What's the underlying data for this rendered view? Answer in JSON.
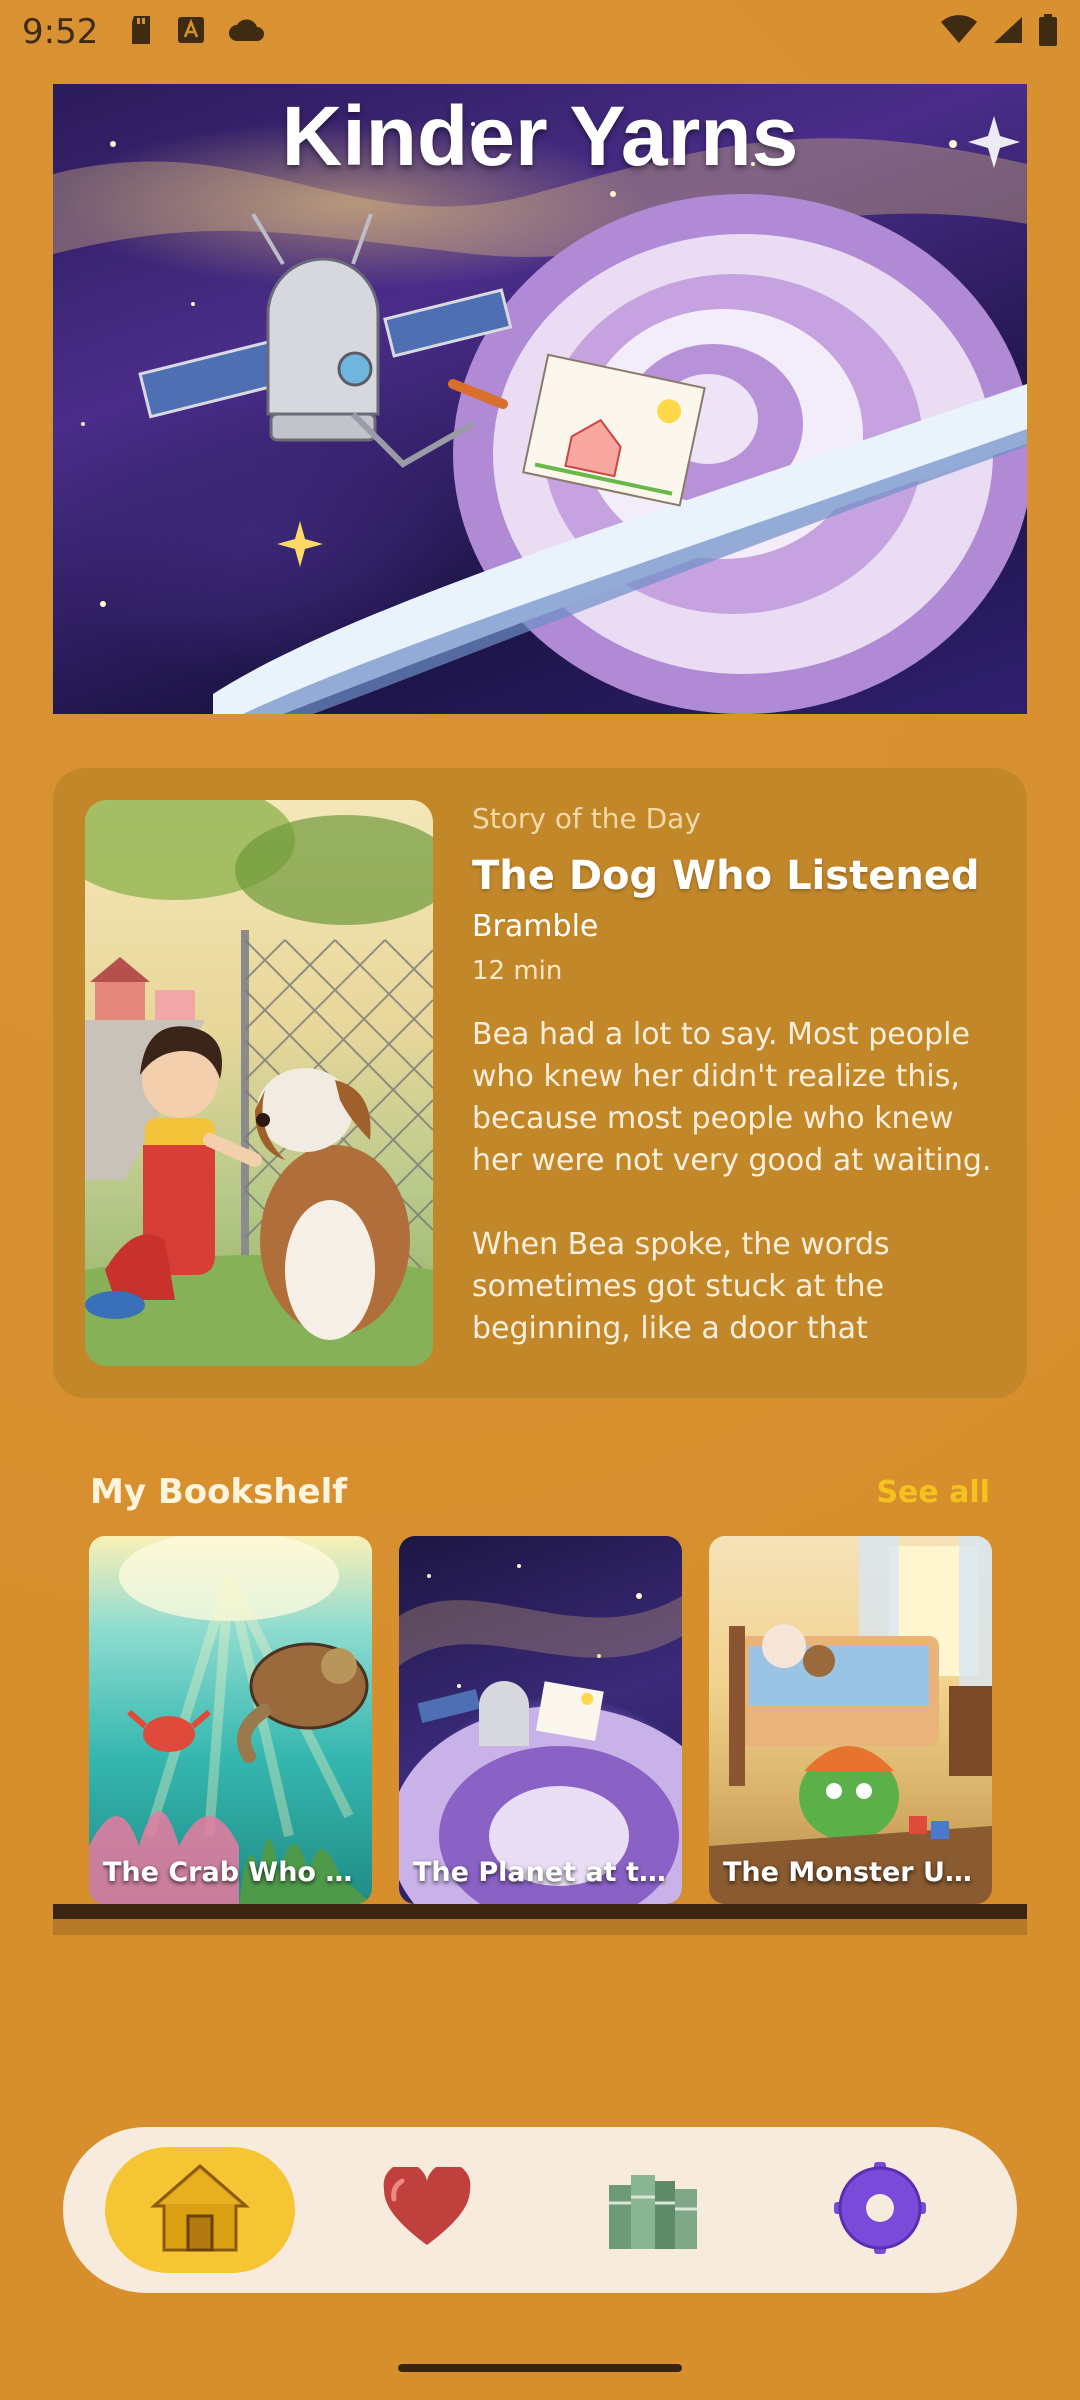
{
  "status_bar": {
    "time": "9:52",
    "left_icons": [
      "sd-card-icon",
      "text-a-icon",
      "cloud-icon"
    ],
    "right_icons": [
      "wifi-icon",
      "signal-icon",
      "battery-icon"
    ]
  },
  "hero": {
    "title": "Kinder Yarns"
  },
  "story_of_the_day": {
    "label": "Story of the Day",
    "title": "The Dog Who Listened",
    "author": "Bramble",
    "duration": "12 min",
    "excerpt": "Bea had a lot to say. Most people who knew her didn't realize this, because most people who knew her were not very good at waiting.\n\nWhen Bea spoke, the words sometimes got stuck at the beginning, like a door that needed…"
  },
  "bookshelf": {
    "title": "My Bookshelf",
    "see_all": "See all",
    "books": [
      {
        "title": "The Crab Who W…"
      },
      {
        "title": "The Planet at th…"
      },
      {
        "title": "The Monster Un…"
      }
    ]
  },
  "nav": {
    "items": [
      {
        "icon": "home-icon",
        "active": true
      },
      {
        "icon": "heart-icon",
        "active": false
      },
      {
        "icon": "books-icon",
        "active": false
      },
      {
        "icon": "settings-gear-icon",
        "active": false
      }
    ]
  },
  "colors": {
    "background": "#d78f2e",
    "card": "#c28729",
    "accent": "#f6c21d",
    "nav_bg": "#f7ebdd"
  }
}
